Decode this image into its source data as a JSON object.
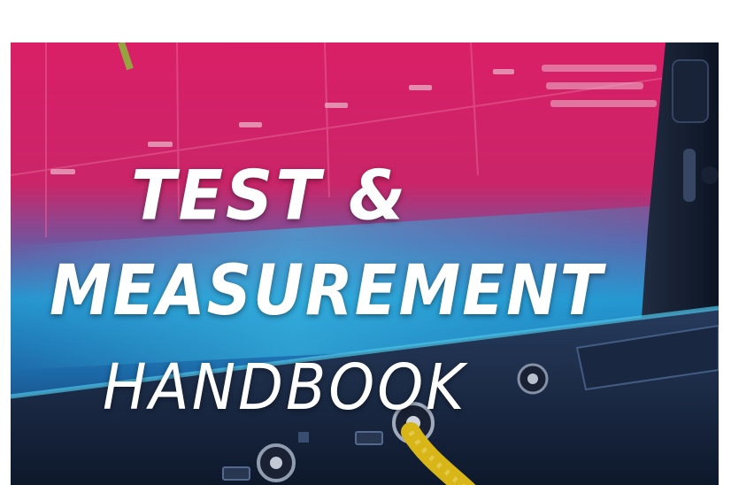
{
  "banner": {
    "title_line_1": "TEST &",
    "title_line_2": "MEASUREMENT",
    "title_line_3": "HANDBOOK"
  },
  "colors": {
    "magenta": "#e21f6e",
    "cyan": "#22b3e6",
    "text": "#ffffff",
    "cable": "#e6c21a"
  }
}
